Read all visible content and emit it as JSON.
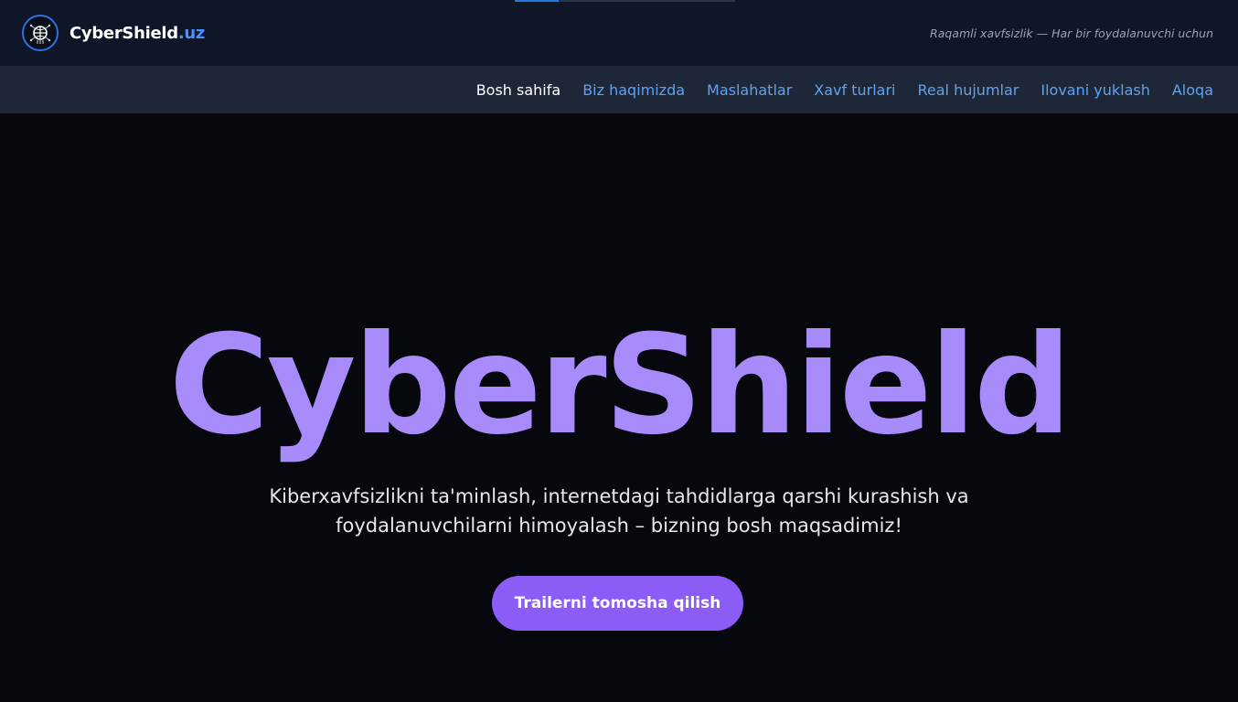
{
  "header": {
    "brand_name": "CyberShield",
    "brand_tld": ".uz",
    "tagline": "Raqamli xavfsizlik — Har bir foydalanuvchi uchun",
    "logo_icon": "shield-circuit-icon",
    "scroll_progress": 0.2
  },
  "nav": {
    "items": [
      {
        "label": "Bosh sahifa",
        "active": true
      },
      {
        "label": "Biz haqimizda"
      },
      {
        "label": "Maslahatlar"
      },
      {
        "label": "Xavf turlari"
      },
      {
        "label": "Real hujumlar"
      },
      {
        "label": "Ilovani yuklash"
      },
      {
        "label": "Aloqa"
      }
    ]
  },
  "hero": {
    "title": "CyberShield",
    "description": "Kiberxavfsizlikni ta'minlash, internetdagi tahdidlarga qarshi kurashish va foydalanuvchilarni himoyalash – bizning bosh maqsadimiz!",
    "cta_label": "Trailerni tomosha qilish"
  },
  "colors": {
    "accent_purple": "#a78bfa",
    "button_purple": "#8b5cf6",
    "link_blue": "#5fa2f0",
    "header_bg": "#0f1628",
    "nav_bg": "#1e2738"
  }
}
